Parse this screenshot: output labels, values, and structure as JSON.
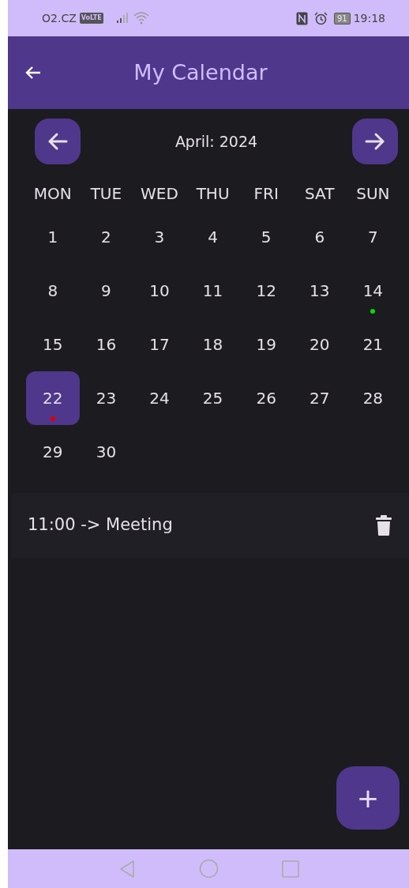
{
  "status_bar": {
    "carrier": "O2.CZ",
    "network_badge": "VoLTE",
    "battery": "91",
    "time": "19:18"
  },
  "app_bar": {
    "title": "My Calendar"
  },
  "month_nav": {
    "label": "April: 2024"
  },
  "weekdays": [
    "MON",
    "TUE",
    "WED",
    "THU",
    "FRI",
    "SAT",
    "SUN"
  ],
  "days": [
    {
      "label": "1",
      "selected": false
    },
    {
      "label": "2",
      "selected": false
    },
    {
      "label": "3",
      "selected": false
    },
    {
      "label": "4",
      "selected": false
    },
    {
      "label": "5",
      "selected": false
    },
    {
      "label": "6",
      "selected": false
    },
    {
      "label": "7",
      "selected": false
    },
    {
      "label": "8",
      "selected": false
    },
    {
      "label": "9",
      "selected": false
    },
    {
      "label": "10",
      "selected": false
    },
    {
      "label": "11",
      "selected": false
    },
    {
      "label": "12",
      "selected": false
    },
    {
      "label": "13",
      "selected": false
    },
    {
      "label": "14",
      "selected": false,
      "color": "#00e000"
    },
    {
      "label": "15",
      "selected": false
    },
    {
      "label": "16",
      "selected": false
    },
    {
      "label": "17",
      "selected": false
    },
    {
      "label": "18",
      "selected": false
    },
    {
      "label": "19",
      "selected": false
    },
    {
      "label": "20",
      "selected": false
    },
    {
      "label": "21",
      "selected": false
    },
    {
      "label": "22",
      "selected": true,
      "color": "#e00000"
    },
    {
      "label": "23",
      "selected": false
    },
    {
      "label": "24",
      "selected": false
    },
    {
      "label": "25",
      "selected": false
    },
    {
      "label": "26",
      "selected": false
    },
    {
      "label": "27",
      "selected": false
    },
    {
      "label": "28",
      "selected": false
    },
    {
      "label": "29",
      "selected": false
    },
    {
      "label": "30",
      "selected": false
    }
  ],
  "events": [
    {
      "text": "11:00 -> Meeting"
    }
  ],
  "fab": {
    "label": "+"
  }
}
